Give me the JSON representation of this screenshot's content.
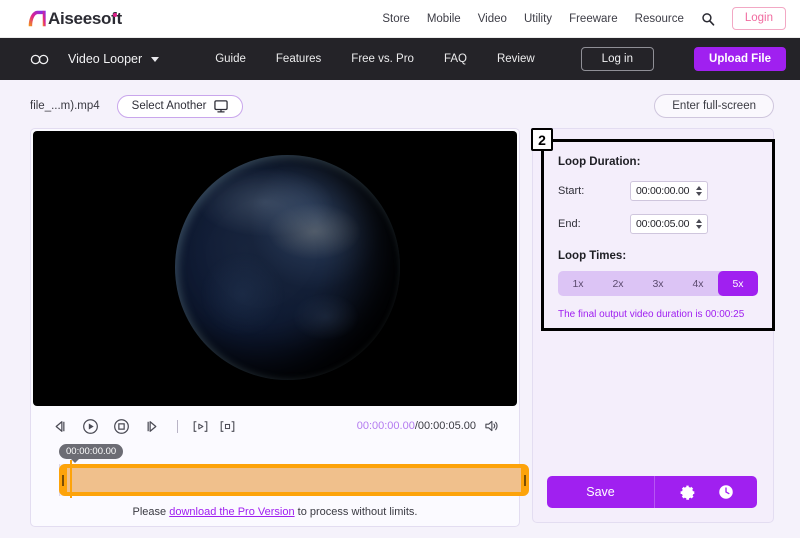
{
  "topbar": {
    "logo_text": "Aiseesoft",
    "nav": [
      {
        "label": "Store"
      },
      {
        "label": "Mobile"
      },
      {
        "label": "Video"
      },
      {
        "label": "Utility"
      },
      {
        "label": "Freeware"
      },
      {
        "label": "Resource"
      }
    ],
    "search_icon": "search-icon",
    "login_label": "Login"
  },
  "darknav": {
    "loop_icon": "infinity-icon",
    "product": "Video Looper",
    "links": [
      {
        "label": "Guide"
      },
      {
        "label": "Features"
      },
      {
        "label": "Free vs. Pro"
      },
      {
        "label": "FAQ"
      },
      {
        "label": "Review"
      }
    ],
    "login_label": "Log in",
    "upload_label": "Upload File"
  },
  "filebar": {
    "filename": "file_...m).mp4",
    "select_another_label": "Select Another",
    "monitor_icon": "monitor-icon",
    "fullscreen_label": "Enter full-screen"
  },
  "player": {
    "controls": [
      {
        "name": "previous-frame-icon"
      },
      {
        "name": "play-icon"
      },
      {
        "name": "stop-icon"
      },
      {
        "name": "next-frame-icon"
      },
      {
        "name": "set-start-bracket-icon"
      },
      {
        "name": "set-end-bracket-icon"
      }
    ],
    "current_time": "00:00:00.00",
    "total_time": "/00:00:05.00",
    "volume_icon": "volume-icon",
    "timeline_tooltip": "00:00:00.00",
    "pro_note_prefix": "Please ",
    "pro_note_link": "download the Pro Version",
    "pro_note_suffix": " to process without limits."
  },
  "panel": {
    "badge": "2",
    "loop_duration_title": "Loop Duration:",
    "start_label": "Start:",
    "start_value": "00:00:00.00",
    "end_label": "End:",
    "end_value": "00:00:05.00",
    "loop_times_title": "Loop Times:",
    "loop_options": [
      {
        "label": "1x",
        "active": false
      },
      {
        "label": "2x",
        "active": false
      },
      {
        "label": "3x",
        "active": false
      },
      {
        "label": "4x",
        "active": false
      },
      {
        "label": "5x",
        "active": true
      }
    ],
    "final_note_text": "The final output video duration is ",
    "final_duration": "00:00:25",
    "save_label": "Save",
    "settings_icon": "gear-icon",
    "history_icon": "clock-icon"
  },
  "colors": {
    "accent_purple": "#a020f0",
    "nav_dark": "#242328",
    "timeline_orange": "#fda30a",
    "login_pink": "#f16ba0"
  }
}
